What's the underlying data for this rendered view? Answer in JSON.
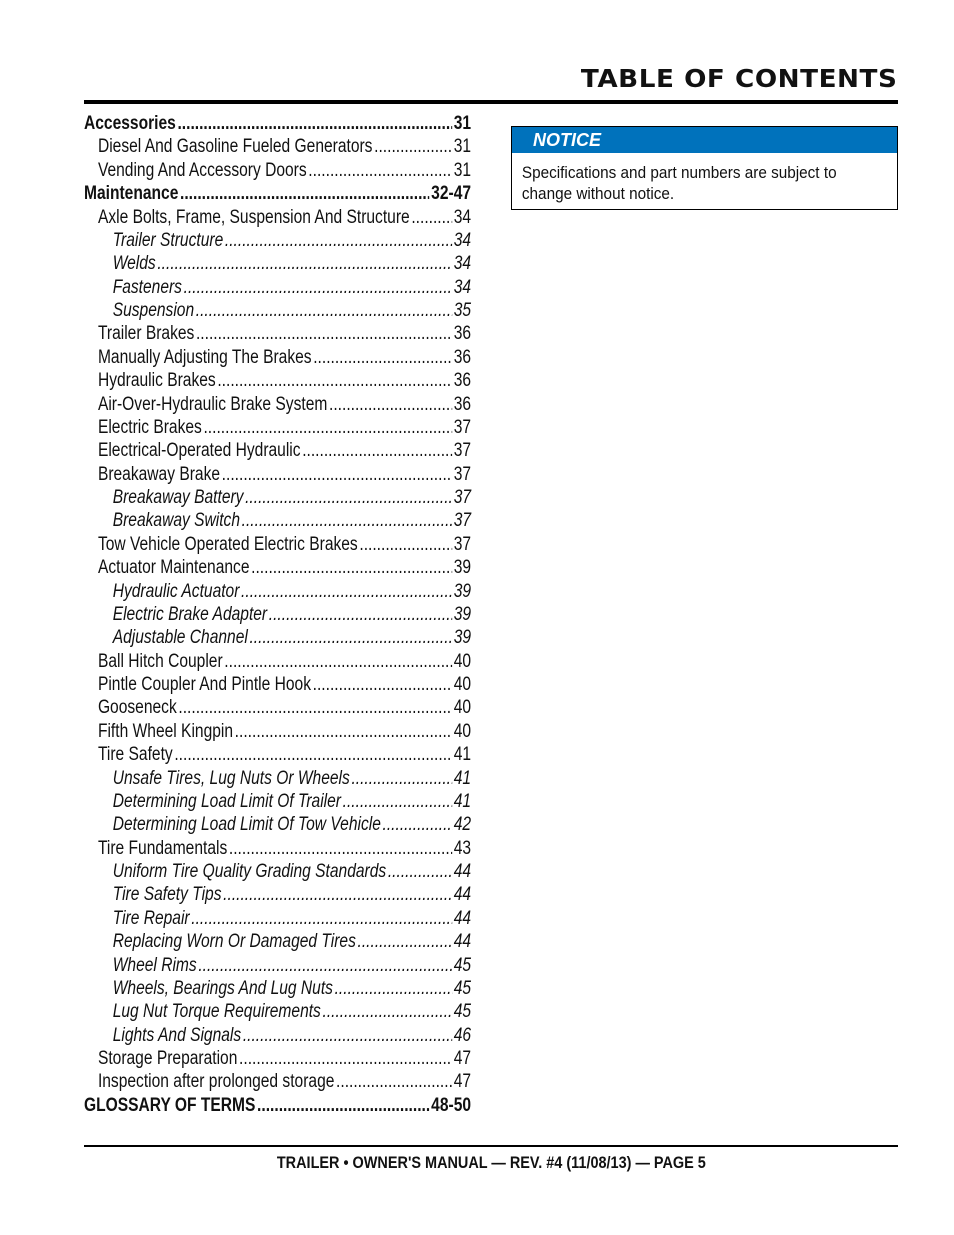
{
  "header": {
    "title": "TABLE OF CONTENTS"
  },
  "toc": [
    {
      "label": "Accessories",
      "page": "31",
      "level": 0
    },
    {
      "label": "Diesel And Gasoline Fueled Generators",
      "page": "31",
      "level": 1
    },
    {
      "label": "Vending And Accessory Doors",
      "page": "31",
      "level": 1
    },
    {
      "label": "Maintenance",
      "page": "32-47",
      "level": 0
    },
    {
      "label": "Axle Bolts, Frame, Suspension And Structure",
      "page": "34",
      "level": 1
    },
    {
      "label": "Trailer Structure",
      "page": "34",
      "level": 2
    },
    {
      "label": "Welds",
      "page": "34",
      "level": 2
    },
    {
      "label": "Fasteners",
      "page": "34",
      "level": 2
    },
    {
      "label": "Suspension",
      "page": "35",
      "level": 2
    },
    {
      "label": "Trailer Brakes",
      "page": "36",
      "level": 1
    },
    {
      "label": "Manually Adjusting The Brakes",
      "page": "36",
      "level": 1
    },
    {
      "label": "Hydraulic Brakes",
      "page": "36",
      "level": 1
    },
    {
      "label": "Air-Over-Hydraulic Brake System",
      "page": "36",
      "level": 1
    },
    {
      "label": "Electric Brakes",
      "page": "37",
      "level": 1
    },
    {
      "label": "Electrical-Operated Hydraulic",
      "page": "37",
      "level": 1
    },
    {
      "label": "Breakaway Brake",
      "page": "37",
      "level": 1
    },
    {
      "label": "Breakaway Battery",
      "page": "37",
      "level": 2
    },
    {
      "label": "Breakaway Switch",
      "page": "37",
      "level": 2
    },
    {
      "label": "Tow Vehicle Operated  Electric Brakes",
      "page": "37",
      "level": 1
    },
    {
      "label": "Actuator Maintenance",
      "page": "39",
      "level": 1
    },
    {
      "label": "Hydraulic Actuator",
      "page": "39",
      "level": 2
    },
    {
      "label": "Electric Brake Adapter",
      "page": "39",
      "level": 2
    },
    {
      "label": "Adjustable Channel",
      "page": "39",
      "level": 2
    },
    {
      "label": "Ball Hitch Coupler",
      "page": "40",
      "level": 1
    },
    {
      "label": "Pintle Coupler And Pintle Hook",
      "page": "40",
      "level": 1
    },
    {
      "label": "Gooseneck",
      "page": "40",
      "level": 1
    },
    {
      "label": "Fifth Wheel Kingpin",
      "page": "40",
      "level": 1
    },
    {
      "label": "Tire Safety",
      "page": "41",
      "level": 1
    },
    {
      "label": "Unsafe Tires, Lug Nuts Or Wheels",
      "page": "41",
      "level": 2
    },
    {
      "label": "Determining Load Limit Of Trailer",
      "page": "41",
      "level": 2
    },
    {
      "label": "Determining Load Limit Of Tow Vehicle",
      "page": "42",
      "level": 2
    },
    {
      "label": "Tire Fundamentals",
      "page": "43",
      "level": 1
    },
    {
      "label": "Uniform Tire Quality Grading Standards",
      "page": "44",
      "level": 2
    },
    {
      "label": "Tire Safety Tips",
      "page": "44",
      "level": 2
    },
    {
      "label": "Tire Repair",
      "page": "44",
      "level": 2
    },
    {
      "label": "Replacing Worn Or Damaged Tires",
      "page": "44",
      "level": 2
    },
    {
      "label": "Wheel Rims",
      "page": "45",
      "level": 2
    },
    {
      "label": "Wheels, Bearings And Lug Nuts",
      "page": "45",
      "level": 2
    },
    {
      "label": "Lug Nut Torque Requirements",
      "page": "45",
      "level": 2
    },
    {
      "label": "Lights And Signals",
      "page": "46",
      "level": 2
    },
    {
      "label": "Storage Preparation",
      "page": "47",
      "level": 1
    },
    {
      "label": "Inspection after prolonged storage",
      "page": "47",
      "level": 1
    },
    {
      "label": "GLOSSARY OF TERMS",
      "page": "48-50",
      "level": 0
    }
  ],
  "notice": {
    "heading": "NOTICE",
    "body": "Specifications and part numbers are subject to change without notice.",
    "color": "#0072bc"
  },
  "footer": {
    "text": "TRAILER • OWNER'S MANUAL — REV. #4 (11/08/13) — PAGE 5"
  }
}
